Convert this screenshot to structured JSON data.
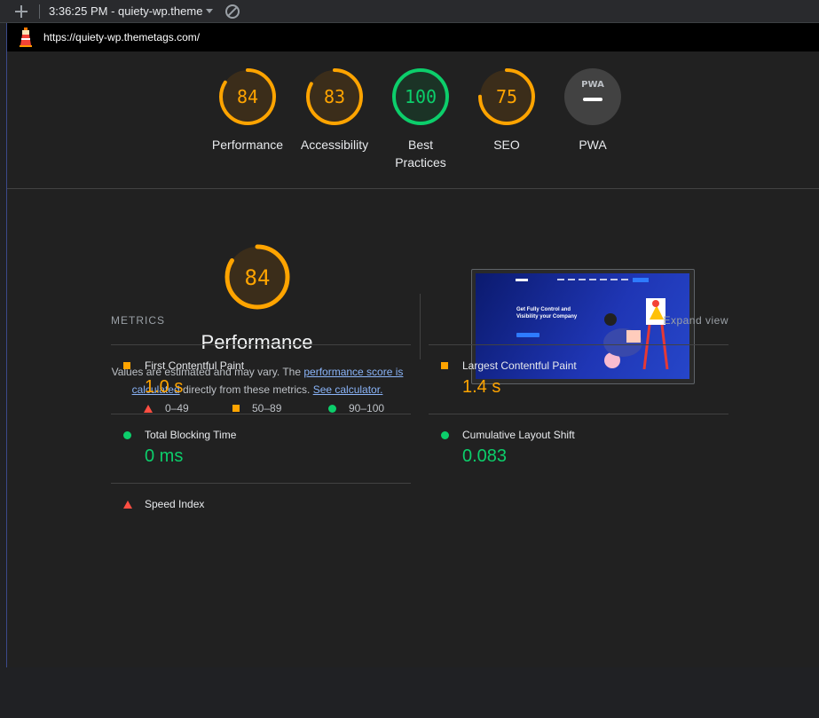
{
  "toolbar": {
    "report_label": "3:36:25 PM - quiety-wp.theme"
  },
  "url": "https://quiety-wp.themetags.com/",
  "gauges": [
    {
      "score": "84",
      "label": "Performance",
      "status": "average"
    },
    {
      "score": "83",
      "label": "Accessibility",
      "status": "average"
    },
    {
      "score": "100",
      "label": "Best Practices",
      "status": "pass"
    },
    {
      "score": "75",
      "label": "SEO",
      "status": "average"
    },
    {
      "score": "",
      "label": "PWA",
      "badge": "PWA",
      "status": "na"
    }
  ],
  "colors": {
    "average": "#ffa400",
    "pass": "#0cce6b",
    "fail": "#ff4e42"
  },
  "performance": {
    "score": "84",
    "title": "Performance",
    "desc_prefix": "Values are estimated and may vary. The ",
    "desc_link1": "performance score is calculated",
    "desc_mid": " directly from these metrics. ",
    "desc_link2": "See calculator.",
    "legend": [
      {
        "range": "0–49",
        "icon": "triangle-icon"
      },
      {
        "range": "50–89",
        "icon": "square-icon"
      },
      {
        "range": "90–100",
        "icon": "circle-icon"
      }
    ],
    "screenshot_headline": "Get Fully Control and Visibility your Company"
  },
  "metrics": {
    "heading": "METRICS",
    "expand_label": "Expand view",
    "items": [
      {
        "name": "First Contentful Paint",
        "value": "1.0 s",
        "status": "average"
      },
      {
        "name": "Largest Contentful Paint",
        "value": "1.4 s",
        "status": "average"
      },
      {
        "name": "Total Blocking Time",
        "value": "0 ms",
        "status": "pass"
      },
      {
        "name": "Cumulative Layout Shift",
        "value": "0.083",
        "status": "pass"
      },
      {
        "name": "Speed Index",
        "value": "",
        "status": "fail"
      }
    ]
  }
}
